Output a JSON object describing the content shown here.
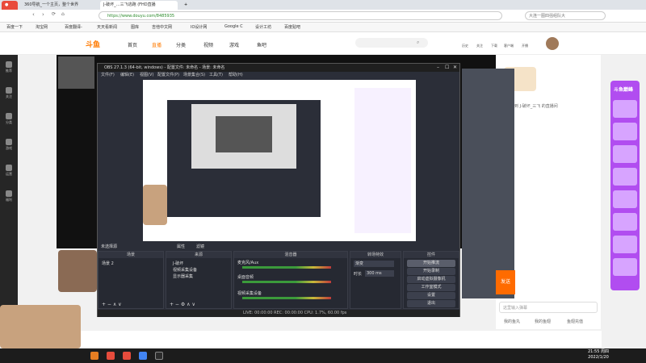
{
  "browser": {
    "tabs": [
      {
        "label": "360导航_一个主页，整个世界",
        "active": false
      },
      {
        "label": "J-破坏_…三飞逃跑 (FHD直播",
        "active": true
      }
    ],
    "url": "https://www.douyu.com/8485935",
    "search_placeholder": "大连一图四强组队大",
    "bookmarks": [
      "百度一下",
      "淘宝网",
      "百度翻译-",
      "天天看新闻",
      "图库",
      "吉他中文网",
      "IO设计网",
      "Google C",
      "设计工坊",
      "百度贴吧"
    ]
  },
  "site": {
    "logo": "斗鱼",
    "nav": [
      "首页",
      "直播",
      "分类",
      "视频",
      "游戏",
      "鱼吧"
    ],
    "header_icons": [
      "历史",
      "关注",
      "下载",
      "客户端",
      "开播",
      "鱼吧"
    ]
  },
  "leftrail": [
    "推荐",
    "关注",
    "分类",
    "游戏",
    "运营",
    "福利"
  ],
  "obs": {
    "title": "OBS 27.1.3 (64-bit, windows) - 配置文件: 未命名 - 场景: 未命名",
    "menu": [
      "文件(F)",
      "编辑(E)",
      "视图(V)",
      "配置文件(P)",
      "场景集合(S)",
      "工具(T)",
      "帮助(H)"
    ],
    "no_source": "未选择源",
    "properties": "属性",
    "filters": "滤镜",
    "panels": {
      "scenes": {
        "title": "场景",
        "items": [
          "场景 2"
        ]
      },
      "sources": {
        "title": "来源",
        "items": [
          "J-破坏",
          "视频采集设备",
          "显示器采集"
        ]
      },
      "mixer": {
        "title": "混音器",
        "tracks": [
          "麦克风/Aux",
          "桌面音频",
          "视频采集设备"
        ]
      },
      "transitions": {
        "title": "转场特效",
        "type": "渐变",
        "duration_label": "时长",
        "duration": "300 ms"
      },
      "controls": {
        "title": "控件",
        "buttons": [
          "开始推流",
          "开始录制",
          "启动虚拟摄像机",
          "工作室模式",
          "设置",
          "退出"
        ]
      }
    },
    "status": "LIVE: 00:00:00  REC: 00:00:00  CPU: 1.7%, 60.00 fps"
  },
  "chat": {
    "notice": "欢迎来到 J-破坏_三飞 的直播间",
    "send_button": "发送",
    "input_placeholder": "这里输入弹幕",
    "footer": [
      "我的鱼丸",
      "我的鱼翅",
      "鱼翅充值"
    ]
  },
  "promos": [
    "斗鱼巅峰",
    "福利",
    "签到"
  ],
  "clock": {
    "time": "21:55 周四",
    "date": "2022/1/20"
  }
}
